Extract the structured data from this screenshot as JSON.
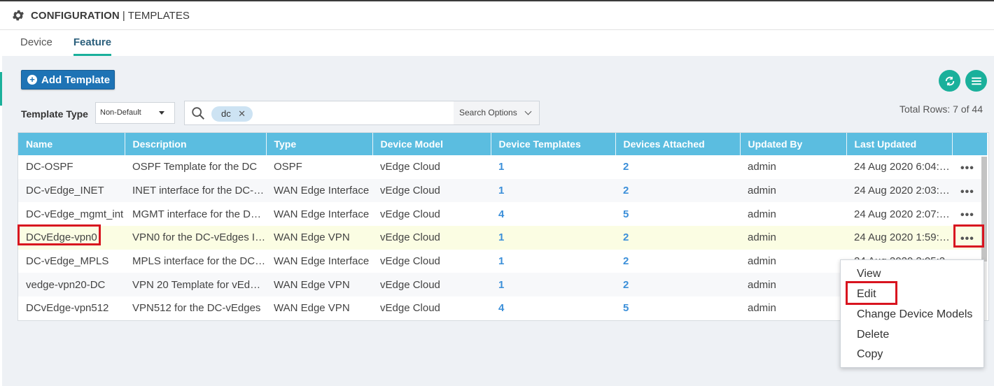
{
  "header": {
    "title": "CONFIGURATION",
    "separator": "|",
    "subtitle": "TEMPLATES",
    "icon": "gear-icon"
  },
  "tabs": [
    {
      "label": "Device",
      "active": false
    },
    {
      "label": "Feature",
      "active": true
    }
  ],
  "toolbar": {
    "add_template_label": "Add Template",
    "template_type_label": "Template Type",
    "template_type_value": "Non-Default",
    "search_chip": "dc",
    "search_options_label": "Search Options",
    "total_rows": "Total Rows: 7 of 44"
  },
  "colors": {
    "accent": "#1ab09b",
    "header_blue": "#5bbde0",
    "button_blue": "#1e73b5",
    "link_blue": "#3b8fd9",
    "highlight_red": "#d8141f"
  },
  "table": {
    "columns": [
      "Name",
      "Description",
      "Type",
      "Device Model",
      "Device Templates",
      "Devices Attached",
      "Updated By",
      "Last Updated"
    ],
    "rows": [
      {
        "name": "DC-OSPF",
        "description": "OSPF Template for the DC",
        "type": "OSPF",
        "model": "vEdge Cloud",
        "templates": "1",
        "attached": "2",
        "by": "admin",
        "updated": "24 Aug 2020 6:04:1..."
      },
      {
        "name": "DC-vEdge_INET",
        "description": "INET interface for the DC-v...",
        "type": "WAN Edge Interface",
        "model": "vEdge Cloud",
        "templates": "1",
        "attached": "2",
        "by": "admin",
        "updated": "24 Aug 2020 2:03:2..."
      },
      {
        "name": "DC-vEdge_mgmt_int",
        "description": "MGMT interface for the DC-...",
        "type": "WAN Edge Interface",
        "model": "vEdge Cloud",
        "templates": "4",
        "attached": "5",
        "by": "admin",
        "updated": "24 Aug 2020 2:07:0..."
      },
      {
        "name": "DCvEdge-vpn0",
        "description": "VPN0 for the DC-vEdges IN...",
        "type": "WAN Edge VPN",
        "model": "vEdge Cloud",
        "templates": "1",
        "attached": "2",
        "by": "admin",
        "updated": "24 Aug 2020 1:59:3..."
      },
      {
        "name": "DC-vEdge_MPLS",
        "description": "MPLS interface for the DC-...",
        "type": "WAN Edge Interface",
        "model": "vEdge Cloud",
        "templates": "1",
        "attached": "2",
        "by": "admin",
        "updated": "24 Aug 2020 2:05:2"
      },
      {
        "name": "vedge-vpn20-DC",
        "description": "VPN 20 Template for vEdge...",
        "type": "WAN Edge VPN",
        "model": "vEdge Cloud",
        "templates": "1",
        "attached": "2",
        "by": "admin",
        "updated": ""
      },
      {
        "name": "DCvEdge-vpn512",
        "description": "VPN512 for the DC-vEdges",
        "type": "WAN Edge VPN",
        "model": "vEdge Cloud",
        "templates": "4",
        "attached": "5",
        "by": "admin",
        "updated": ""
      }
    ],
    "actions_glyph": "•••"
  },
  "context_menu": {
    "items": [
      "View",
      "Edit",
      "Change Device Models",
      "Delete",
      "Copy"
    ]
  }
}
